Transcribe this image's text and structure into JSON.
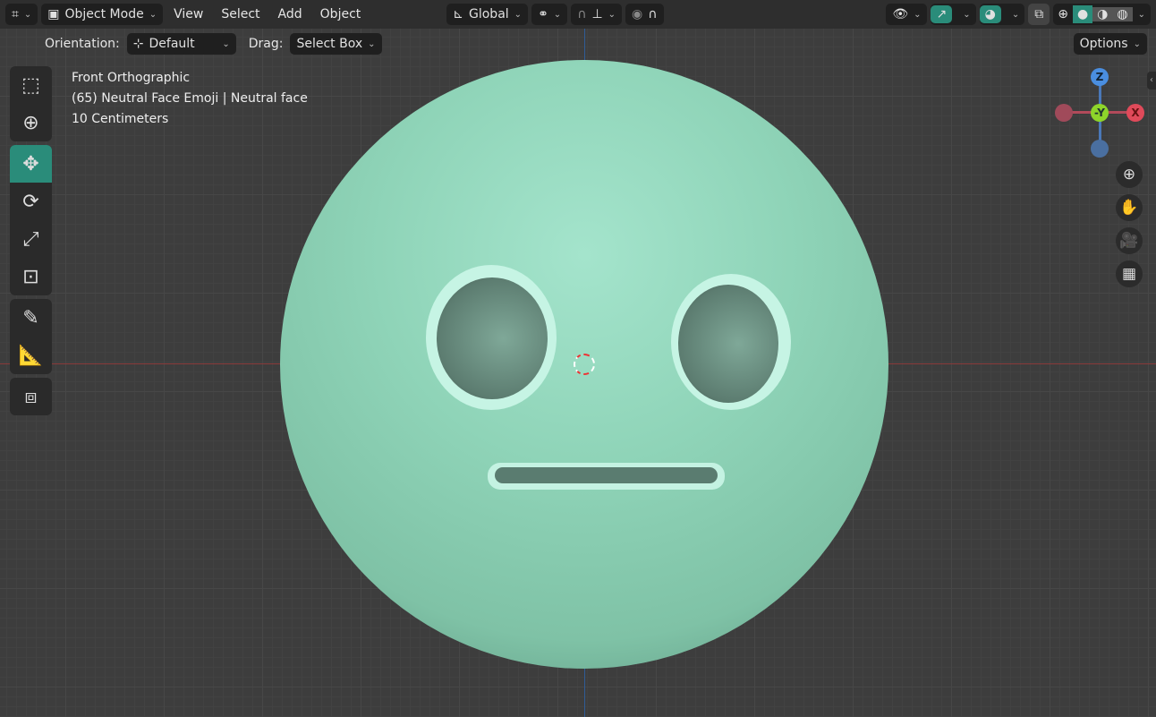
{
  "header": {
    "mode": "Object Mode",
    "menus": [
      "View",
      "Select",
      "Add",
      "Object"
    ],
    "orientation_global": "Global"
  },
  "subheader": {
    "orientation_label": "Orientation:",
    "orientation_value": "Default",
    "drag_label": "Drag:",
    "drag_value": "Select Box",
    "options": "Options"
  },
  "overlay_info": {
    "view": "Front Orthographic",
    "object": "(65) Neutral Face Emoji | Neutral face",
    "scale": "10 Centimeters"
  },
  "gizmo": {
    "z": "Z",
    "y": "-Y",
    "x": "X"
  },
  "colors": {
    "accent": "#2a8c7a",
    "face": "#8fd4b8"
  }
}
